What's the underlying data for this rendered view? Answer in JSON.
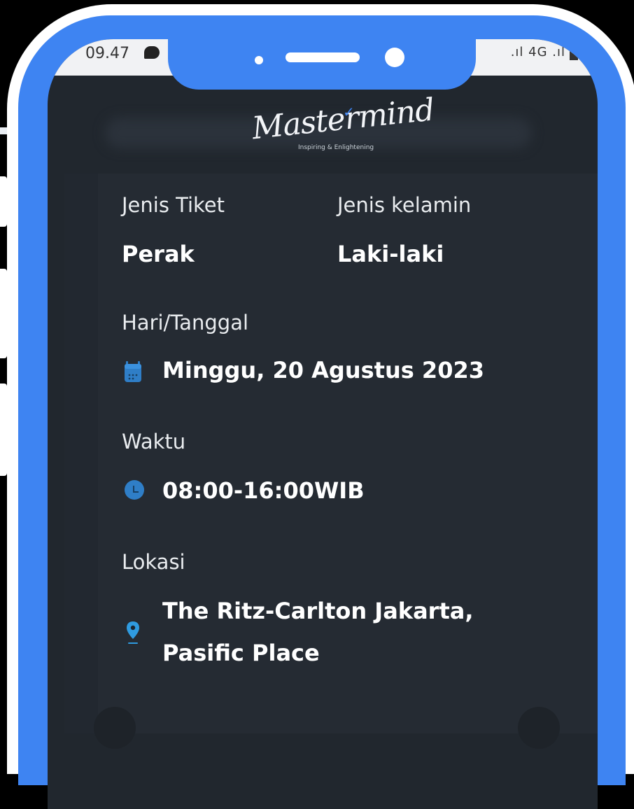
{
  "statusbar": {
    "time": "09.47",
    "signal": ".ıl 4G .ıl"
  },
  "brand": {
    "name": "Mastermind",
    "tagline": "Inspiring & Enlightening"
  },
  "ticket": {
    "ticket_type_label": "Jenis Tiket",
    "ticket_type_value": "Perak",
    "gender_label": "Jenis kelamin",
    "gender_value": "Laki-laki",
    "date_label": "Hari/Tanggal",
    "date_value": "Minggu, 20 Agustus 2023",
    "time_label": "Waktu",
    "time_value": "08:00-16:00WIB",
    "location_label": "Lokasi",
    "location_line1": "The Ritz-Carlton Jakarta,",
    "location_line2": "Pasific Place"
  },
  "colors": {
    "frame_blue": "#3e84f2",
    "screen_bg": "#21272e",
    "card_bg": "#252b33",
    "icon_blue": "#2f7ec7"
  },
  "icons": [
    "calendar-icon",
    "clock-icon",
    "location-pin-icon",
    "message-icon",
    "battery-icon"
  ]
}
